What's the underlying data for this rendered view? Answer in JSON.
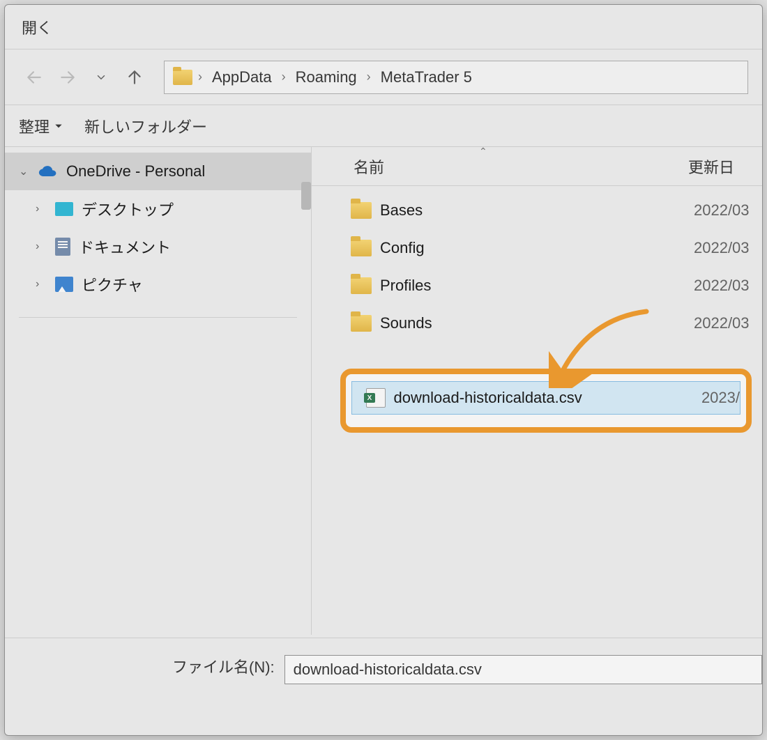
{
  "title": "開く",
  "breadcrumb": [
    "AppData",
    "Roaming",
    "MetaTrader 5"
  ],
  "toolbar": {
    "organize": "整理",
    "newFolder": "新しいフォルダー"
  },
  "tree": {
    "onedrive": "OneDrive - Personal",
    "desktop": "デスクトップ",
    "documents": "ドキュメント",
    "pictures": "ピクチャ"
  },
  "columns": {
    "name": "名前",
    "date": "更新日"
  },
  "files": [
    {
      "name": "Bases",
      "type": "folder",
      "date": "2022/03"
    },
    {
      "name": "Config",
      "type": "folder",
      "date": "2022/03"
    },
    {
      "name": "Profiles",
      "type": "folder",
      "date": "2022/03"
    },
    {
      "name": "Sounds",
      "type": "folder",
      "date": "2022/03"
    },
    {
      "name": "download-historicaldata.csv",
      "type": "excel",
      "date": "2023/"
    }
  ],
  "filenameLabel": "ファイル名(N):",
  "filenameValue": "download-historicaldata.csv"
}
